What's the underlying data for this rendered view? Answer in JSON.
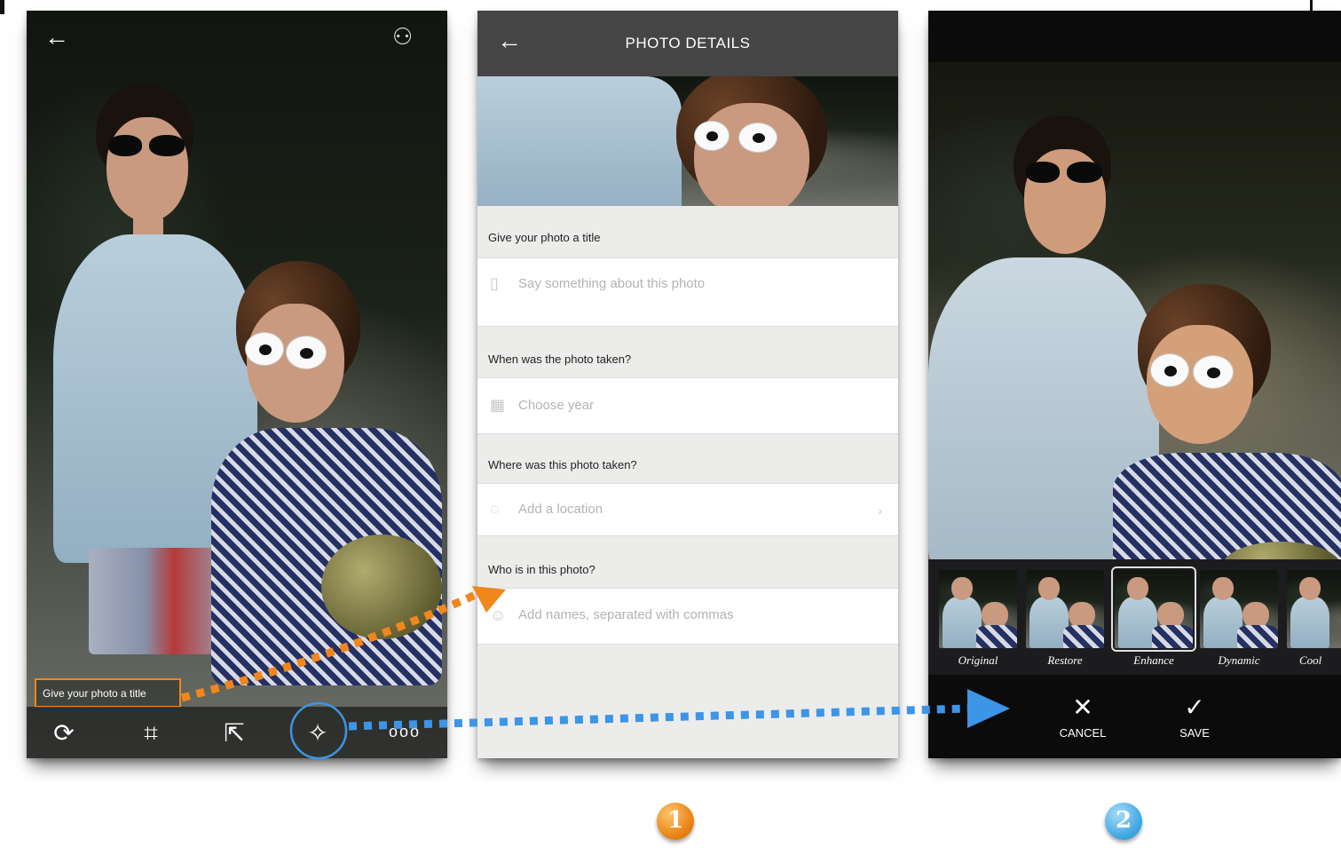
{
  "screen_edit": {
    "give_title_field": "Give your photo a title",
    "toolbar": {
      "rotate_icon": "rotate-icon",
      "crop_icon": "crop-icon",
      "share_icon": "share-icon",
      "enhance_icon": "magic-wand-icon",
      "more": "ooo"
    }
  },
  "screen_details": {
    "header_title": "PHOTO DETAILS",
    "sections": [
      {
        "label": "Give your photo a title",
        "placeholder": "Say something about this photo"
      },
      {
        "label": "When was the photo taken?",
        "placeholder": "Choose year"
      },
      {
        "label": "Where was this photo taken?",
        "placeholder": "Add a location"
      },
      {
        "label": "Who is in this photo?",
        "placeholder": "Add names, separated with commas"
      }
    ]
  },
  "screen_filters": {
    "filters": [
      "Original",
      "Restore",
      "Enhance",
      "Dynamic",
      "Cool"
    ],
    "selected_filter": "Enhance",
    "cancel_label": "CANCEL",
    "save_label": "SAVE"
  },
  "steps": {
    "one": "1",
    "two": "2"
  },
  "colors": {
    "accent_orange": "#f0861c",
    "accent_blue": "#3c95e6"
  }
}
